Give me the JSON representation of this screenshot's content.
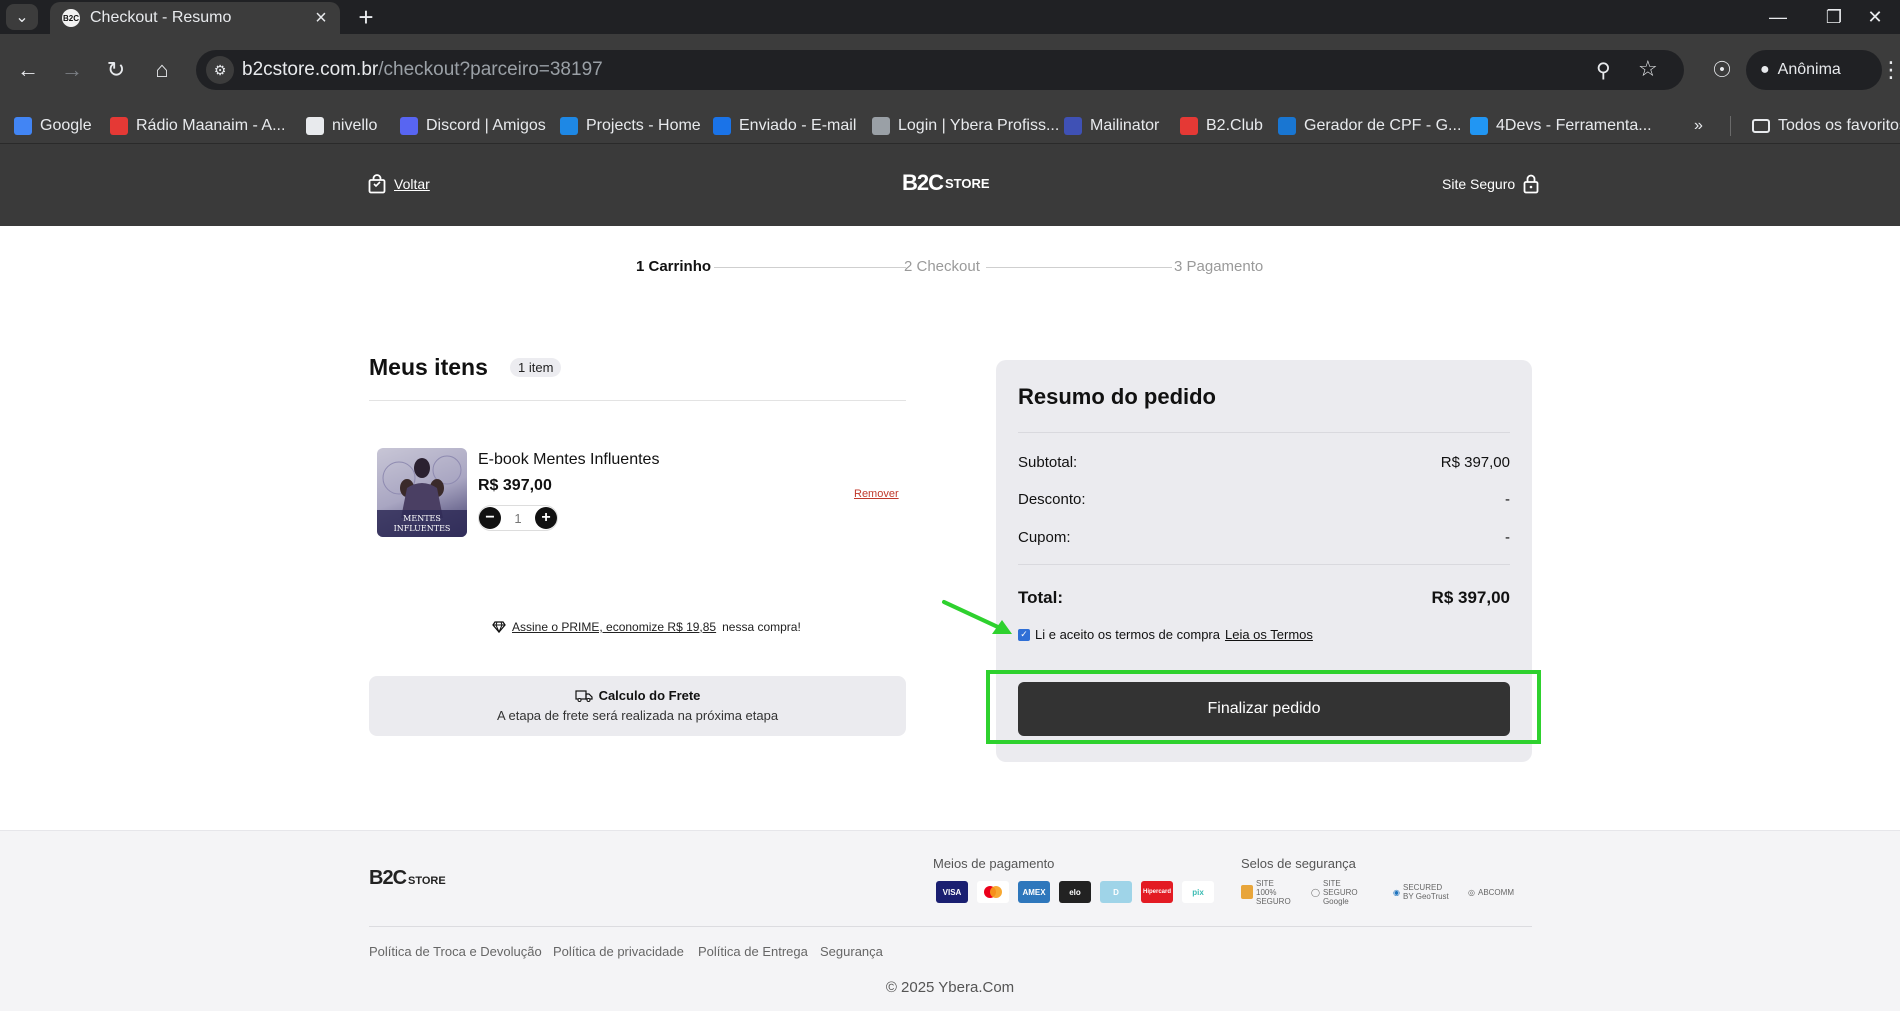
{
  "browser": {
    "tab_title": "Checkout - Resumo",
    "favicon_text": "B2C",
    "url_host": "b2cstore.com.br",
    "url_path": "/checkout?parceiro=38197",
    "profile_label": "Anônima",
    "bookmarks": [
      {
        "label": "Google",
        "icon": "google-icon",
        "color": "#4285f4"
      },
      {
        "label": "Rádio Maanaim - A...",
        "icon": "radio-icon",
        "color": "#e53935"
      },
      {
        "label": "nivello",
        "icon": "folder-icon",
        "color": "#e8eaed"
      },
      {
        "label": "Discord | Amigos",
        "icon": "discord-icon",
        "color": "#5865f2"
      },
      {
        "label": "Projects - Home",
        "icon": "azure-icon",
        "color": "#1e88e5"
      },
      {
        "label": "Enviado - E-mail",
        "icon": "mail-icon",
        "color": "#1a73e8"
      },
      {
        "label": "Login | Ybera Profiss...",
        "icon": "globe-icon",
        "color": "#9aa0a6"
      },
      {
        "label": "Mailinator",
        "icon": "mailinator-icon",
        "color": "#3f51b5"
      },
      {
        "label": "B2.Club",
        "icon": "b2club-icon",
        "color": "#e53935"
      },
      {
        "label": "Gerador de CPF - G...",
        "icon": "nv-icon",
        "color": "#1976d2"
      },
      {
        "label": "4Devs - Ferramenta...",
        "icon": "4devs-icon",
        "color": "#2196f3"
      }
    ],
    "all_bookmarks_label": "Todos os favoritos"
  },
  "header": {
    "back_label": "Voltar",
    "logo_text": "B2C",
    "logo_suffix": "STORE",
    "secure_label": "Site Seguro"
  },
  "steps": [
    {
      "label": "1 Carrinho",
      "active": true
    },
    {
      "label": "2 Checkout",
      "active": false
    },
    {
      "label": "3 Pagamento",
      "active": false
    }
  ],
  "items": {
    "title": "Meus itens",
    "count_badge": "1 item",
    "list": [
      {
        "name": "E-book Mentes Influentes",
        "price": "R$ 397,00",
        "quantity": "1",
        "image_caption": "MENTES INFLUENTES",
        "remove_label": "Remover"
      }
    ]
  },
  "prime": {
    "link_text": "Assine o PRIME, economize R$ 19,85",
    "suffix": "nessa compra!"
  },
  "shipping": {
    "title": "Calculo do Frete",
    "text": "A etapa de frete será realizada na próxima etapa"
  },
  "summary": {
    "title": "Resumo do pedido",
    "rows": [
      {
        "label": "Subtotal:",
        "value": "R$ 397,00"
      },
      {
        "label": "Desconto:",
        "value": "-"
      },
      {
        "label": "Cupom:",
        "value": "-"
      }
    ],
    "total_label": "Total:",
    "total_value": "R$ 397,00",
    "terms_text": "Li e aceito os termos de compra",
    "terms_link": "Leia os Termos",
    "terms_checked": true,
    "finalize_label": "Finalizar pedido"
  },
  "annotation": {
    "highlight_color": "#2ed12e"
  },
  "footer": {
    "logo_text": "B2C",
    "logo_suffix": "STORE",
    "payments_title": "Meios de pagamento",
    "payments": [
      {
        "label": "VISA",
        "bg": "#1a1f71"
      },
      {
        "label": "MC",
        "bg": "#ffffff"
      },
      {
        "label": "AMEX",
        "bg": "#2e77bc"
      },
      {
        "label": "elo",
        "bg": "#222222"
      },
      {
        "label": "D",
        "bg": "#9fd4e8"
      },
      {
        "label": "Hipercard",
        "bg": "#e31b23"
      },
      {
        "label": "pix",
        "bg": "#ffffff"
      }
    ],
    "security_title": "Selos de segurança",
    "seals": [
      "SITE 100% SEGURO",
      "SITE SEGURO Google",
      "SECURED BY GeoTrust",
      "ABCOMM"
    ],
    "policies": [
      "Política de Troca e Devolução",
      "Política de privacidade",
      "Política de Entrega",
      "Segurança"
    ],
    "copyright": "© 2025 Ybera.Com"
  }
}
